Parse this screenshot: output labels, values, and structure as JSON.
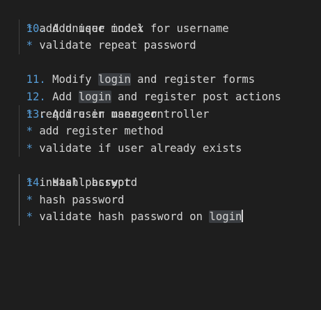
{
  "editor": {
    "lines": [
      {
        "number": "10.",
        "text": "Add user model"
      },
      {
        "bullet": "*",
        "text": "add unique index for username"
      },
      {
        "bullet": "*",
        "text": "validate repeat password"
      },
      {
        "number": "11.",
        "before": "Modify ",
        "highlight": "login",
        "after": " and register forms"
      },
      {
        "number": "12.",
        "before": "Add ",
        "highlight": "login",
        "after": " and register post actions"
      },
      {
        "number": "13.",
        "text": "Add user manager"
      },
      {
        "bullet": "*",
        "text": "require in user controller"
      },
      {
        "bullet": "*",
        "text": "add register method"
      },
      {
        "bullet": "*",
        "text": "validate if user already exists"
      },
      {
        "number": "14.",
        "text": "Hash password"
      },
      {
        "bullet": "*",
        "text": "install bcrypt"
      },
      {
        "bullet": "*",
        "text": "hash password"
      },
      {
        "bullet": "*",
        "before": "validate hash password on ",
        "highlight": "login",
        "cursor": true
      }
    ]
  },
  "colors": {
    "background": "#1e1e1e",
    "text": "#d4d4d4",
    "list_marker": "#569cd6",
    "word_highlight": "#3a3d41"
  }
}
